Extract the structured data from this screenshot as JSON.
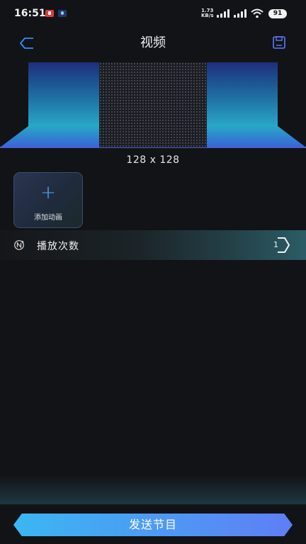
{
  "status_bar": {
    "time": "16:51",
    "net_speed_value": "1.73",
    "net_speed_unit": "KB/s",
    "battery": "91"
  },
  "header": {
    "title": "视频",
    "back_icon": "back-arrow-icon",
    "save_icon": "save-icon"
  },
  "preview": {
    "canvas_size": "128 x 128",
    "stage_colors": {
      "top": "#1e3a8f",
      "mid": "#26a1c4",
      "bottom": "#2f6cd6"
    }
  },
  "add_animation": {
    "icon": "plus-icon",
    "label": "添加动画"
  },
  "play_count": {
    "icon": "loop-icon",
    "label": "播放次数",
    "value": "1"
  },
  "footer": {
    "send_label": "发送节目",
    "accent_start": "#3bb7f2",
    "accent_end": "#5f7ef5"
  }
}
